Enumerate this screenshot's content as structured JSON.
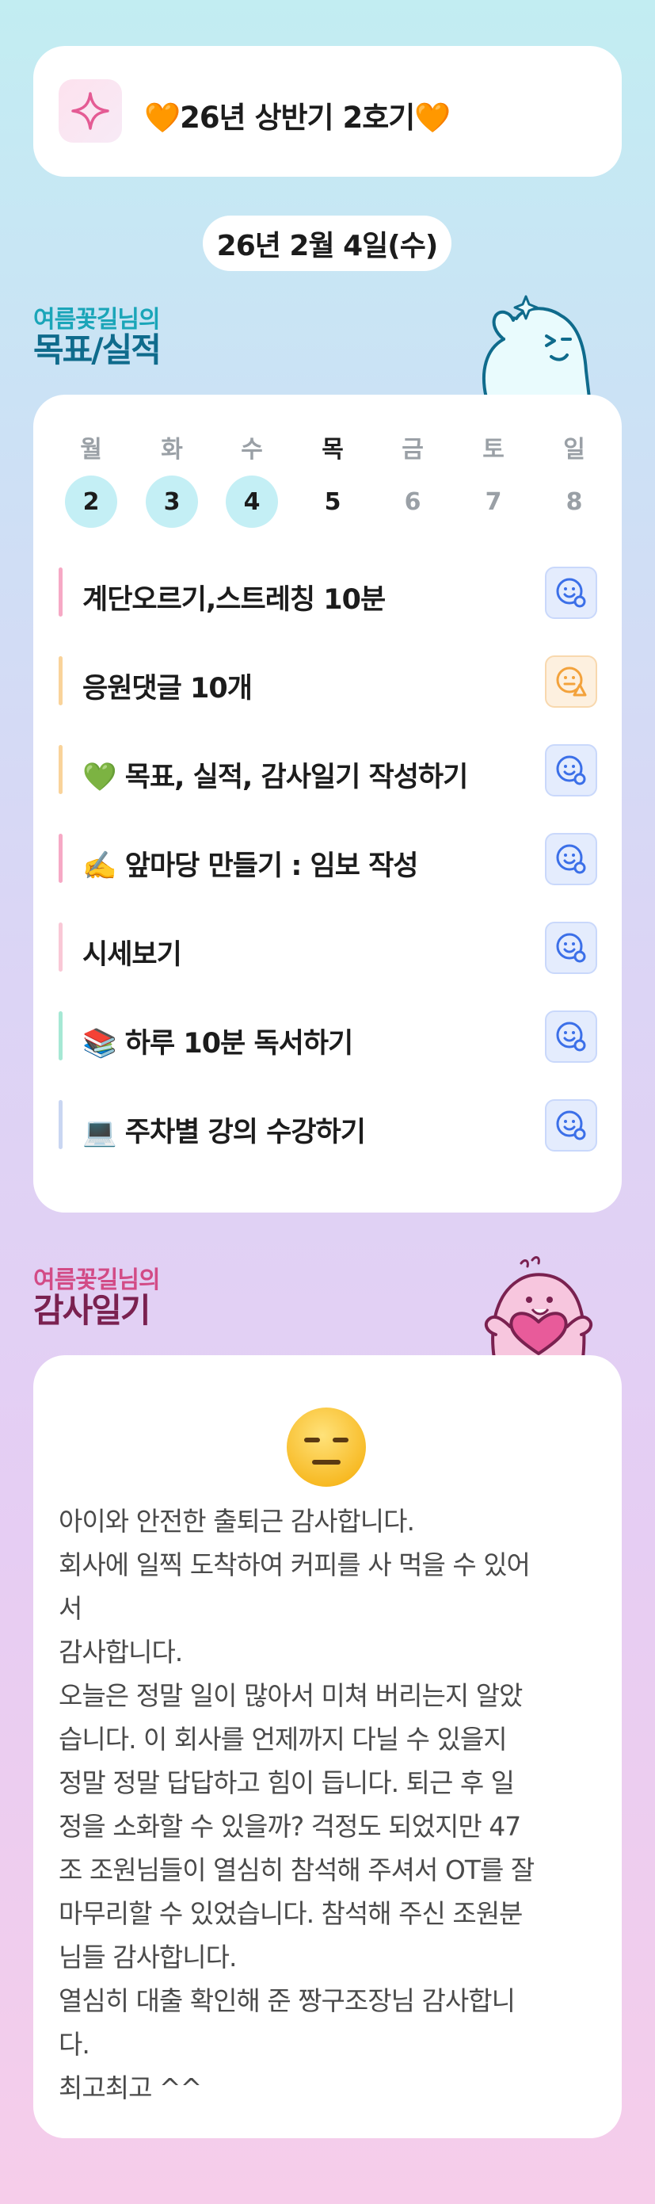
{
  "header": {
    "title": "🧡26년 상반기 2호기🧡",
    "icon": "sparkle-icon"
  },
  "date_label": "26년 2월 4일(수)",
  "goals_section": {
    "owner": "여름꽃길님의",
    "title": "목표/실적"
  },
  "week": [
    {
      "name": "월",
      "num": "2",
      "state": "done"
    },
    {
      "name": "화",
      "num": "3",
      "state": "done"
    },
    {
      "name": "수",
      "num": "4",
      "state": "done"
    },
    {
      "name": "목",
      "num": "5",
      "state": "today"
    },
    {
      "name": "금",
      "num": "6",
      "state": "future"
    },
    {
      "name": "토",
      "num": "7",
      "state": "future"
    },
    {
      "name": "일",
      "num": "8",
      "state": "future"
    }
  ],
  "tasks": [
    {
      "label": "계단오르기,스트레칭 10분",
      "bar_color": "#f6a9c5",
      "status": "blue-smile-icon"
    },
    {
      "label": "응원댓글 10개",
      "bar_color": "#f9d39a",
      "status": "orange-warning-icon"
    },
    {
      "label": "💚 목표, 실적, 감사일기 작성하기",
      "bar_color": "#f9d39a",
      "status": "blue-smile-icon"
    },
    {
      "label": "✍️ 앞마당 만들기 : 임보 작성",
      "bar_color": "#f6a9c5",
      "status": "blue-smile-icon"
    },
    {
      "label": "시세보기",
      "bar_color": "#f9c8d6",
      "status": "blue-smile-icon"
    },
    {
      "label": "📚 하루 10분 독서하기",
      "bar_color": "#a6e8d4",
      "status": "blue-smile-icon"
    },
    {
      "label": "💻 주차별 강의 수강하기",
      "bar_color": "#c9d6f2",
      "status": "blue-smile-icon"
    }
  ],
  "gratitude_section": {
    "owner": "여름꽃길님의",
    "title": "감사일기"
  },
  "gratitude": {
    "emoji": "expressionless-face-icon",
    "lines": [
      "아이와 안전한 출퇴근 감사합니다.",
      "회사에 일찍 도착하여 커피를 사 먹을 수 있어",
      "서",
      "감사합니다.",
      "오늘은 정말 일이 많아서 미쳐 버리는지 알았",
      "습니다. 이 회사를 언제까지 다닐 수 있을지",
      "정말 정말 답답하고 힘이 듭니다. 퇴근 후 일",
      "정을 소화할 수 있을까? 걱정도 되었지만 47",
      "조 조원님들이 열심히 참석해 주셔서 OT를 잘",
      "마무리할 수 있었습니다. 참석해 주신 조원분",
      "님들 감사합니다.",
      "열심히 대출 확인해 준 짱구조장님 감사합니",
      "다.",
      "최고최고 ^^"
    ]
  },
  "colors": {
    "accent_blue": "#3b6fe8",
    "accent_orange": "#f3a23b",
    "done_circle": "#c4eff5"
  }
}
